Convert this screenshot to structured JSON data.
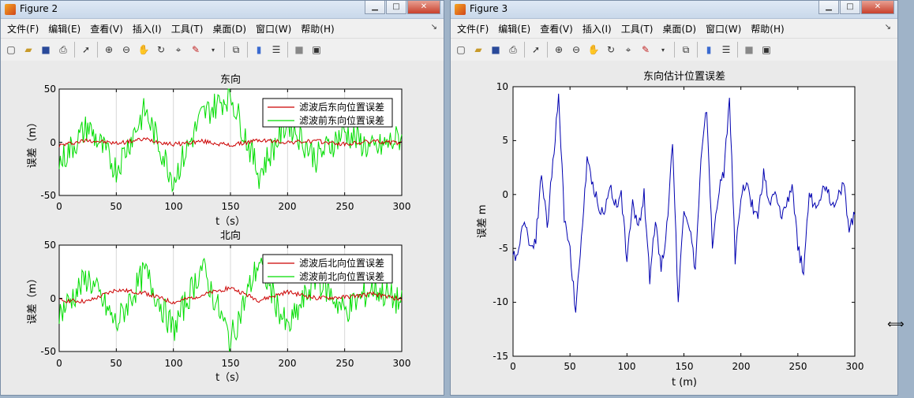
{
  "fig2": {
    "title": "Figure 2",
    "menu": [
      "文件(F)",
      "编辑(E)",
      "查看(V)",
      "插入(I)",
      "工具(T)",
      "桌面(D)",
      "窗口(W)",
      "帮助(H)"
    ],
    "plots": [
      {
        "title": "东向",
        "ylabel": "误差（m）",
        "xlabel": "t（s）",
        "yticks": [
          -50,
          0,
          50
        ],
        "xticks": [
          0,
          50,
          100,
          150,
          200,
          250,
          300
        ],
        "legend": [
          "滤波后东向位置误差",
          "滤波前东向位置误差"
        ]
      },
      {
        "title": "北向",
        "ylabel": "误差（m）",
        "xlabel": "t（s）",
        "yticks": [
          -50,
          0,
          50
        ],
        "xticks": [
          0,
          50,
          100,
          150,
          200,
          250,
          300
        ],
        "legend": [
          "滤波后北向位置误差",
          "滤波前北向位置误差"
        ]
      }
    ]
  },
  "fig3": {
    "title": "Figure 3",
    "menu": [
      "文件(F)",
      "编辑(E)",
      "查看(V)",
      "插入(I)",
      "工具(T)",
      "桌面(D)",
      "窗口(W)",
      "帮助(H)"
    ],
    "plot": {
      "title": "东向估计位置误差",
      "ylabel": "误差 m",
      "xlabel": "t (m)",
      "yticks": [
        -15,
        -10,
        -5,
        0,
        5,
        10
      ],
      "xticks": [
        0,
        50,
        100,
        150,
        200,
        250,
        300
      ]
    }
  },
  "colors": {
    "filtered": "#cc0000",
    "raw": "#00dd00",
    "estimate": "#0000b0"
  },
  "chart_data": [
    {
      "type": "line",
      "title": "东向",
      "xlabel": "t（s）",
      "ylabel": "误差（m）",
      "xlim": [
        0,
        300
      ],
      "ylim": [
        -50,
        50
      ],
      "grid": "x-only",
      "legend_position": "top-right",
      "series": [
        {
          "name": "滤波后东向位置误差",
          "x": [
            0,
            25,
            50,
            75,
            100,
            125,
            150,
            175,
            200,
            225,
            250,
            275,
            300
          ],
          "y": [
            -3,
            2,
            -1,
            3,
            -2,
            1,
            -3,
            2,
            0,
            1,
            -2,
            1,
            -1
          ]
        },
        {
          "name": "滤波前东向位置误差",
          "x": [
            0,
            25,
            50,
            75,
            100,
            125,
            150,
            175,
            200,
            225,
            250,
            275,
            300
          ],
          "y": [
            -20,
            15,
            -25,
            30,
            -35,
            25,
            45,
            -30,
            20,
            -15,
            10,
            -8,
            5
          ]
        }
      ]
    },
    {
      "type": "line",
      "title": "北向",
      "xlabel": "t（s）",
      "ylabel": "误差（m）",
      "xlim": [
        0,
        300
      ],
      "ylim": [
        -50,
        50
      ],
      "grid": "x-only",
      "legend_position": "top-right",
      "series": [
        {
          "name": "滤波后北向位置误差",
          "x": [
            0,
            25,
            50,
            75,
            100,
            125,
            150,
            175,
            200,
            225,
            250,
            275,
            300
          ],
          "y": [
            -2,
            -3,
            8,
            5,
            -4,
            3,
            10,
            -2,
            6,
            0,
            1,
            4,
            -1
          ]
        },
        {
          "name": "滤波前北向位置误差",
          "x": [
            0,
            25,
            50,
            75,
            100,
            125,
            150,
            175,
            200,
            225,
            250,
            275,
            300
          ],
          "y": [
            -15,
            20,
            -25,
            25,
            -30,
            30,
            -40,
            35,
            -30,
            20,
            -12,
            10,
            -5
          ]
        }
      ]
    },
    {
      "type": "line",
      "title": "东向估计位置误差",
      "xlabel": "t (m)",
      "ylabel": "误差 m",
      "xlim": [
        0,
        300
      ],
      "ylim": [
        -15,
        10
      ],
      "grid": "off",
      "series": [
        {
          "x": [
            0,
            5,
            10,
            15,
            20,
            25,
            30,
            35,
            40,
            45,
            50,
            55,
            60,
            65,
            70,
            75,
            80,
            85,
            90,
            95,
            100,
            105,
            110,
            115,
            120,
            125,
            130,
            135,
            140,
            145,
            150,
            155,
            160,
            165,
            170,
            175,
            180,
            185,
            190,
            195,
            200,
            205,
            210,
            215,
            220,
            225,
            230,
            235,
            240,
            245,
            250,
            255,
            260,
            265,
            270,
            275,
            280,
            285,
            290,
            295,
            300
          ],
          "y": [
            -6,
            -5,
            -2,
            -5,
            -4,
            2,
            -3,
            3,
            9,
            -2,
            -5,
            -11,
            -4,
            3,
            1,
            -1,
            -2,
            1,
            -1,
            0,
            -6,
            -1,
            -3,
            0,
            -8,
            -2,
            -7,
            -3,
            5,
            -10,
            -1,
            -3,
            -7,
            3,
            8,
            -5,
            0,
            2,
            9,
            -6,
            0,
            1,
            -1,
            -2,
            2,
            -1,
            0,
            -2,
            -1,
            1,
            -5,
            -7,
            0,
            -1,
            0,
            1,
            -1,
            0,
            1,
            -3,
            -2
          ]
        }
      ]
    }
  ]
}
